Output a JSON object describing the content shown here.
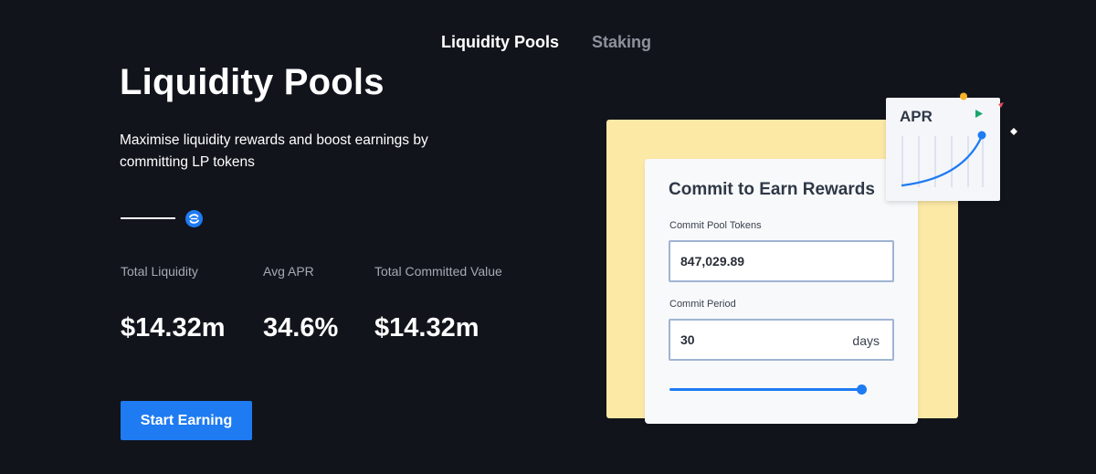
{
  "nav": {
    "tabs": [
      {
        "label": "Liquidity Pools",
        "active": true
      },
      {
        "label": "Staking",
        "active": false
      }
    ]
  },
  "hero": {
    "title": "Liquidity Pools",
    "subtitle": "Maximise liquidity rewards and boost earnings by committing LP tokens",
    "brand_icon": "swirl-logo-icon"
  },
  "stats": [
    {
      "label": "Total Liquidity",
      "value": "$14.32m"
    },
    {
      "label": "Avg APR",
      "value": "34.6%"
    },
    {
      "label": "Total Committed Value",
      "value": "$14.32m"
    }
  ],
  "cta": {
    "label": "Start Earning"
  },
  "illustration": {
    "form": {
      "title": "Commit to Earn Rewards",
      "pool_tokens_label": "Commit Pool Tokens",
      "pool_tokens_value": "847,029.89",
      "period_label": "Commit Period",
      "period_value": "30",
      "period_unit": "days",
      "slider_level": 1.0
    },
    "apr_card": {
      "label": "APR",
      "icon": "play-triangle-icon"
    }
  },
  "colors": {
    "background": "#12141c",
    "accent": "#1e7bf2",
    "illustration_bg": "#fde9a6",
    "muted_text": "#a6aab3"
  }
}
